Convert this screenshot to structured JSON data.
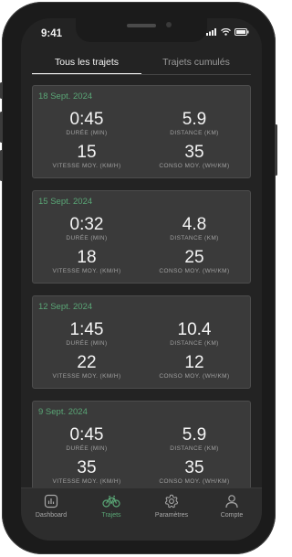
{
  "status_bar": {
    "time": "9:41"
  },
  "tabs": [
    {
      "label": "Tous les trajets",
      "active": true
    },
    {
      "label": "Trajets cumulés",
      "active": false
    }
  ],
  "labels": {
    "duration": "DURÉE (MIN)",
    "distance": "DISTANCE (KM)",
    "speed": "VITESSE MOY. (KM/H)",
    "consumption": "CONSO MOY. (WH/KM)"
  },
  "trips": [
    {
      "date": "18 Sept. 2024",
      "duration": "0:45",
      "distance": "5.9",
      "speed": "15",
      "consumption": "35"
    },
    {
      "date": "15 Sept. 2024",
      "duration": "0:32",
      "distance": "4.8",
      "speed": "18",
      "consumption": "25"
    },
    {
      "date": "12 Sept. 2024",
      "duration": "1:45",
      "distance": "10.4",
      "speed": "22",
      "consumption": "12"
    },
    {
      "date": "9 Sept. 2024",
      "duration": "0:45",
      "distance": "5.9",
      "speed": "35",
      "consumption": "35"
    }
  ],
  "nav": [
    {
      "label": "Dashboard",
      "icon": "dashboard-icon",
      "active": false
    },
    {
      "label": "Trajets",
      "icon": "bike-icon",
      "active": true
    },
    {
      "label": "Paramètres",
      "icon": "gear-icon",
      "active": false
    },
    {
      "label": "Compte",
      "icon": "user-icon",
      "active": false
    }
  ],
  "colors": {
    "accent": "#5aa676",
    "card": "#3a3a3a",
    "background": "#232323"
  }
}
